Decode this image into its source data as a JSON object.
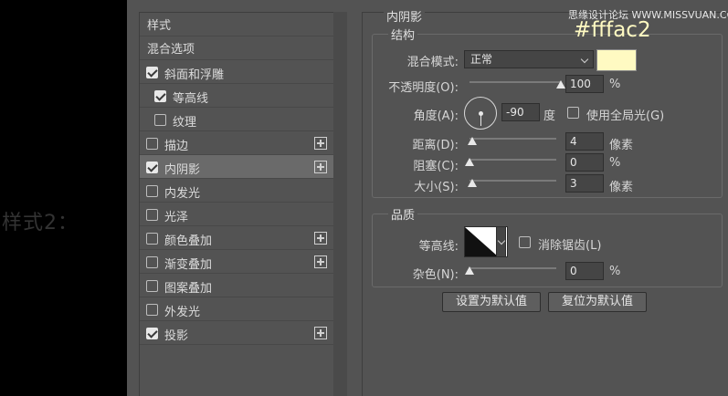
{
  "page_caption": "样式2：",
  "watermark": "思缘设计论坛 WWW.MISSVUAN.COM",
  "color_note": "#fffac2",
  "style_list": {
    "header": "样式",
    "blend_options": "混合选项",
    "items": [
      {
        "label": "斜面和浮雕",
        "checked": true,
        "plus": false,
        "indent": false
      },
      {
        "label": "等高线",
        "checked": true,
        "plus": false,
        "indent": true
      },
      {
        "label": "纹理",
        "checked": false,
        "plus": false,
        "indent": true
      },
      {
        "label": "描边",
        "checked": false,
        "plus": true,
        "indent": false
      },
      {
        "label": "内阴影",
        "checked": true,
        "plus": true,
        "indent": false,
        "selected": true
      },
      {
        "label": "内发光",
        "checked": false,
        "plus": false,
        "indent": false
      },
      {
        "label": "光泽",
        "checked": false,
        "plus": false,
        "indent": false
      },
      {
        "label": "颜色叠加",
        "checked": false,
        "plus": true,
        "indent": false
      },
      {
        "label": "渐变叠加",
        "checked": false,
        "plus": true,
        "indent": false
      },
      {
        "label": "图案叠加",
        "checked": false,
        "plus": false,
        "indent": false
      },
      {
        "label": "外发光",
        "checked": false,
        "plus": false,
        "indent": false
      },
      {
        "label": "投影",
        "checked": true,
        "plus": true,
        "indent": false
      }
    ]
  },
  "panel": {
    "title": "内阴影",
    "structure": {
      "title": "结构",
      "blend_mode_label": "混合模式:",
      "blend_mode_value": "正常",
      "color": "#fffac2",
      "opacity_label": "不透明度(O):",
      "opacity_value": "100",
      "opacity_unit": "%",
      "opacity_level": 1.0,
      "angle_label": "角度(A):",
      "angle_value": "-90",
      "angle_unit": "度",
      "global_light_label": "使用全局光(G)",
      "distance_label": "距离(D):",
      "distance_value": "4",
      "distance_unit": "像素",
      "choke_label": "阻塞(C):",
      "choke_value": "0",
      "choke_unit": "%",
      "size_label": "大小(S):",
      "size_value": "3",
      "size_unit": "像素"
    },
    "quality": {
      "title": "品质",
      "contour_label": "等高线:",
      "anti_alias_label": "消除锯齿(L)",
      "noise_label": "杂色(N):",
      "noise_value": "0",
      "noise_unit": "%"
    },
    "buttons": {
      "set_default": "设置为默认值",
      "reset_default": "复位为默认值"
    }
  }
}
